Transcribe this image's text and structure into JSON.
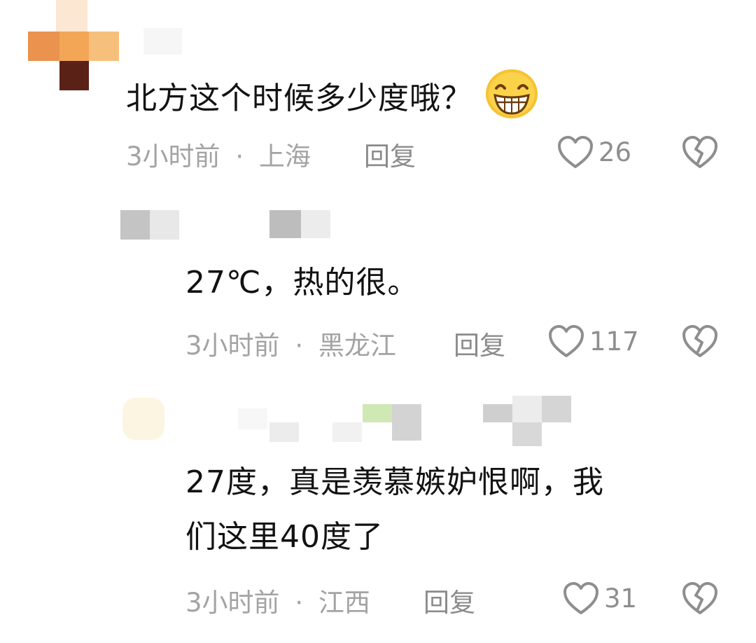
{
  "comments": [
    {
      "text": "北方这个时候多少度哦？",
      "emoji_icon": "grinning-face-emoji",
      "time": "3小时前",
      "location": "上海",
      "reply_label": "回复",
      "likes": "26"
    },
    {
      "text": "27℃，热的很。",
      "time": "3小时前",
      "location": "黑龙江",
      "reply_label": "回复",
      "likes": "117"
    },
    {
      "text_line1": "27度，真是羡慕嫉妒恨啊，我",
      "text_line2": "们这里40度了",
      "time": "3小时前",
      "location": "江西",
      "reply_label": "回复",
      "likes": "31"
    }
  ],
  "meta_separator": "·",
  "icons": {
    "like": "heart-outline-icon",
    "dislike": "broken-heart-icon"
  },
  "colors": {
    "text": "#121212",
    "meta": "#a3a3a3",
    "icon": "#8e8e8e"
  }
}
